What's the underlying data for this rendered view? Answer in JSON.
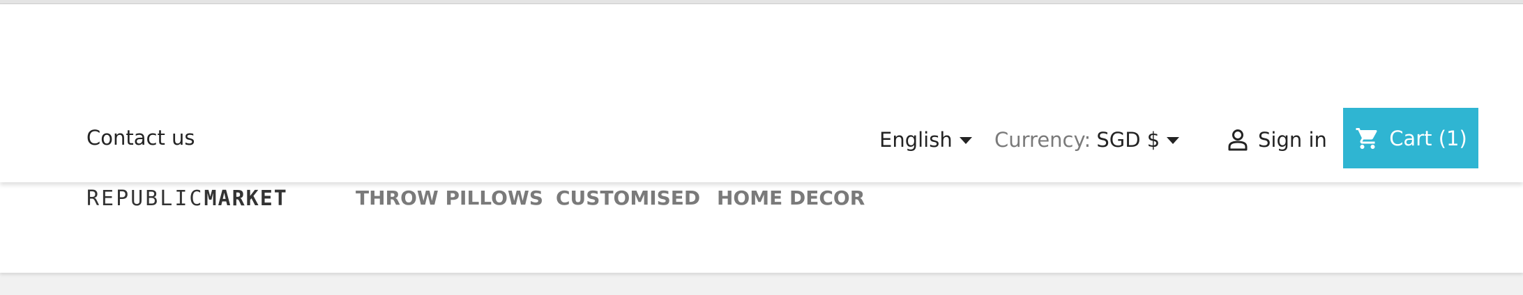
{
  "header": {
    "contact_label": "Contact us",
    "language": {
      "selected": "English"
    },
    "currency": {
      "label": "Currency:",
      "selected": "SGD $"
    },
    "signin_label": "Sign in",
    "cart_label": "Cart (1)"
  },
  "logo": {
    "part1": "REPUBLIC",
    "part2": "MARKET"
  },
  "menu": {
    "items": [
      {
        "label": "THROW PILLOWS"
      },
      {
        "label": "CUSTOMISED"
      },
      {
        "label": "HOME DECOR"
      }
    ]
  },
  "colors": {
    "accent": "#2fb5d2",
    "menu_text": "#7a7a7a",
    "body_text": "#232323"
  },
  "icons": {
    "signin": "user-icon",
    "cart": "shopping-cart-icon",
    "dropdown": "caret-down-icon"
  }
}
